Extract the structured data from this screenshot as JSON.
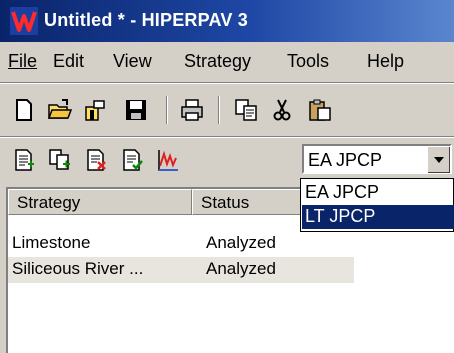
{
  "window": {
    "title": "Untitled * - HIPERPAV 3",
    "icon": "hiperpav-logo-icon"
  },
  "menu": [
    "File",
    "Edit",
    "View",
    "Strategy",
    "Tools",
    "Help"
  ],
  "toolbar1": [
    "new-file-icon",
    "open-folder-icon",
    "open-icon",
    "save-icon",
    "print-icon",
    "copy-icon",
    "cut-icon",
    "paste-icon"
  ],
  "toolbar2": [
    "new-strategy-icon",
    "copy-strategy-icon",
    "delete-strategy-icon",
    "analyze-strategy-icon",
    "chart-icon"
  ],
  "combo": {
    "value": "EA JPCP",
    "options": [
      "EA JPCP",
      "LT JPCP"
    ],
    "highlighted": "LT JPCP"
  },
  "table": {
    "headers": [
      "Strategy",
      "Status"
    ],
    "rows": [
      [
        "Limestone",
        "Analyzed"
      ],
      [
        "Siliceous River ...",
        "Analyzed"
      ]
    ]
  },
  "colors": {
    "title_bar": "#0a246a",
    "selection": "#0a246a",
    "face": "#d4d0c8",
    "logo_red": "#e02020"
  }
}
